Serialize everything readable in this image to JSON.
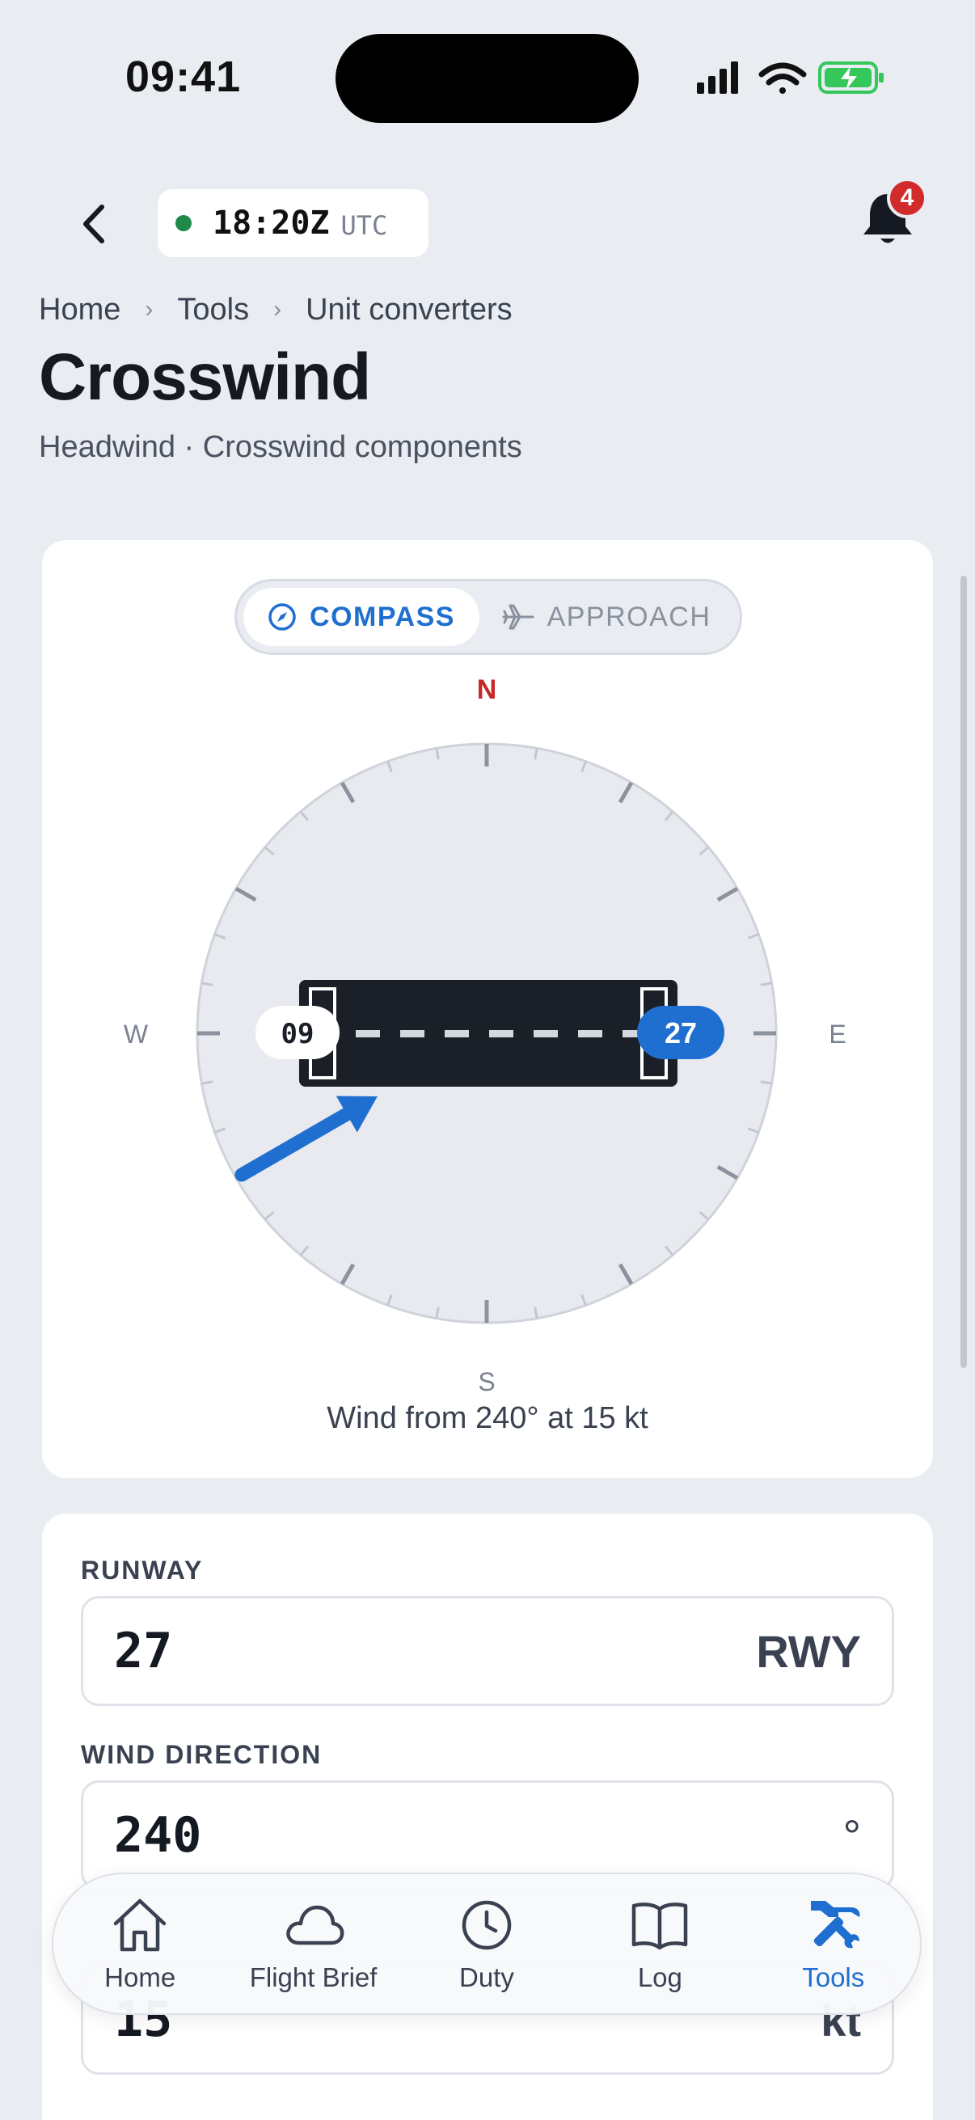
{
  "status_bar": {
    "time": "09:41"
  },
  "top_bar": {
    "utc_time": "18:20Z",
    "utc_label": "UTC",
    "notification_count": "4"
  },
  "breadcrumb": [
    "Home",
    "Tools",
    "Unit converters"
  ],
  "page": {
    "title": "Crosswind",
    "subtitle": "Headwind · Crosswind components"
  },
  "compass_card": {
    "modes": {
      "compass": "COMPASS",
      "approach": "APPROACH",
      "selected": "compass"
    },
    "cardinals": {
      "n": "N",
      "e": "E",
      "s": "S",
      "w": "W"
    },
    "runway_ends": {
      "left": "09",
      "right": "27"
    },
    "wind_direction_deg": 240,
    "caption": "Wind from 240° at 15 kt",
    "colors": {
      "accent": "#1f6fd1",
      "north": "#c62828",
      "runway": "#1b1f27",
      "dial": "#e8eaef"
    }
  },
  "inputs": {
    "runway": {
      "label": "RUNWAY",
      "value": "27",
      "unit": "RWY"
    },
    "wind_direction": {
      "label": "WIND DIRECTION",
      "value": "240",
      "unit": "°"
    },
    "wind_speed": {
      "value": "15",
      "unit": "kt"
    }
  },
  "tabbar": {
    "items": [
      {
        "label": "Home",
        "icon": "home-icon"
      },
      {
        "label": "Flight Brief",
        "icon": "cloud-icon"
      },
      {
        "label": "Duty",
        "icon": "clock-icon"
      },
      {
        "label": "Log",
        "icon": "book-icon"
      },
      {
        "label": "Tools",
        "icon": "tools-icon"
      }
    ],
    "active": "Tools"
  }
}
